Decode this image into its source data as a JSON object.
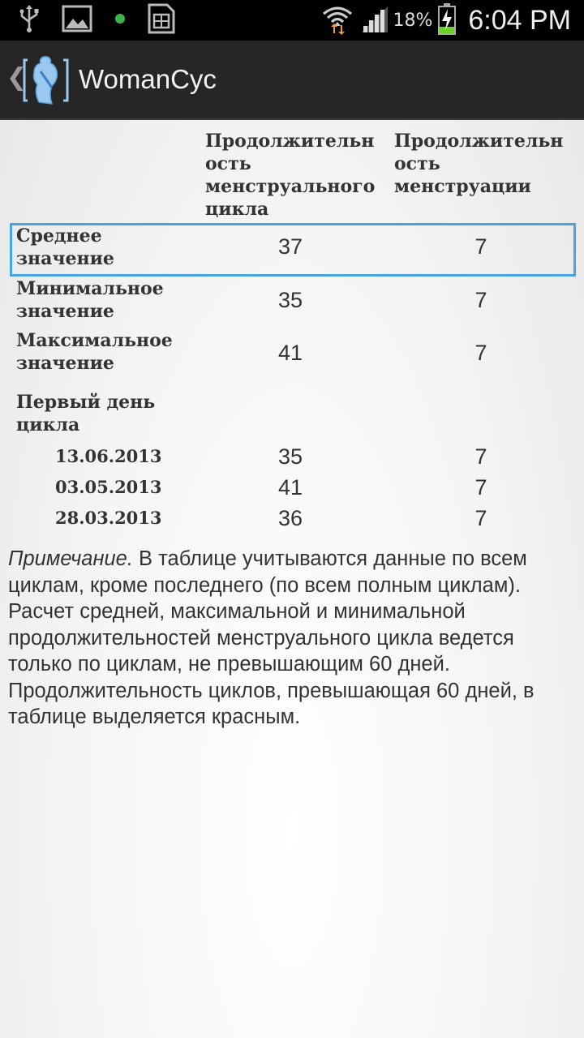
{
  "status_bar": {
    "icons_left": [
      "usb-icon",
      "image-icon",
      "notification-dot-icon",
      "sim-card-icon"
    ],
    "icons_right": [
      "wifi-icon",
      "signal-icon",
      "battery-charging-icon"
    ],
    "battery_percent": "18%",
    "time": "6:04 PM",
    "colors": {
      "dot": "#3bb34a",
      "battery_fill": "#6dd02a",
      "wifi_arrows": "#f0a030"
    }
  },
  "action_bar": {
    "back_icon": "chevron-left-icon",
    "logo_icon": "app-logo-icon",
    "title": "WomanCyc"
  },
  "table": {
    "headers": {
      "cycle_length": [
        "Продолжительн",
        "ость",
        "менструального",
        "цикла"
      ],
      "period_length": [
        "Продолжительн",
        "ость",
        "менструации"
      ]
    },
    "summary_rows": [
      {
        "label": [
          "Среднее",
          "значение"
        ],
        "cycle": "37",
        "period": "7",
        "selected": true
      },
      {
        "label": [
          "Минимальное",
          "значение"
        ],
        "cycle": "35",
        "period": "7",
        "selected": false
      },
      {
        "label": [
          "Максимальное",
          "значение"
        ],
        "cycle": "41",
        "period": "7",
        "selected": false
      }
    ],
    "first_day_label": [
      "Первый день",
      "цикла"
    ],
    "cycle_rows": [
      {
        "date": "13.06.2013",
        "cycle": "35",
        "period": "7"
      },
      {
        "date": "03.05.2013",
        "cycle": "41",
        "period": "7"
      },
      {
        "date": "28.03.2013",
        "cycle": "36",
        "period": "7"
      }
    ],
    "highlight_color": "#4aa3e0"
  },
  "note": {
    "label": "Примечание.",
    "line1": " В таблице учитываются данные по всем циклам, кроме последнего (по всем полным циклам).",
    "line2": "Расчет средней, максимальной и минимальной продолжительностей менструального цикла ведется только по циклам, не превышающим 60 дней.",
    "line3": "Продолжительность циклов, превышающая 60 дней, в таблице выделяется красным."
  }
}
